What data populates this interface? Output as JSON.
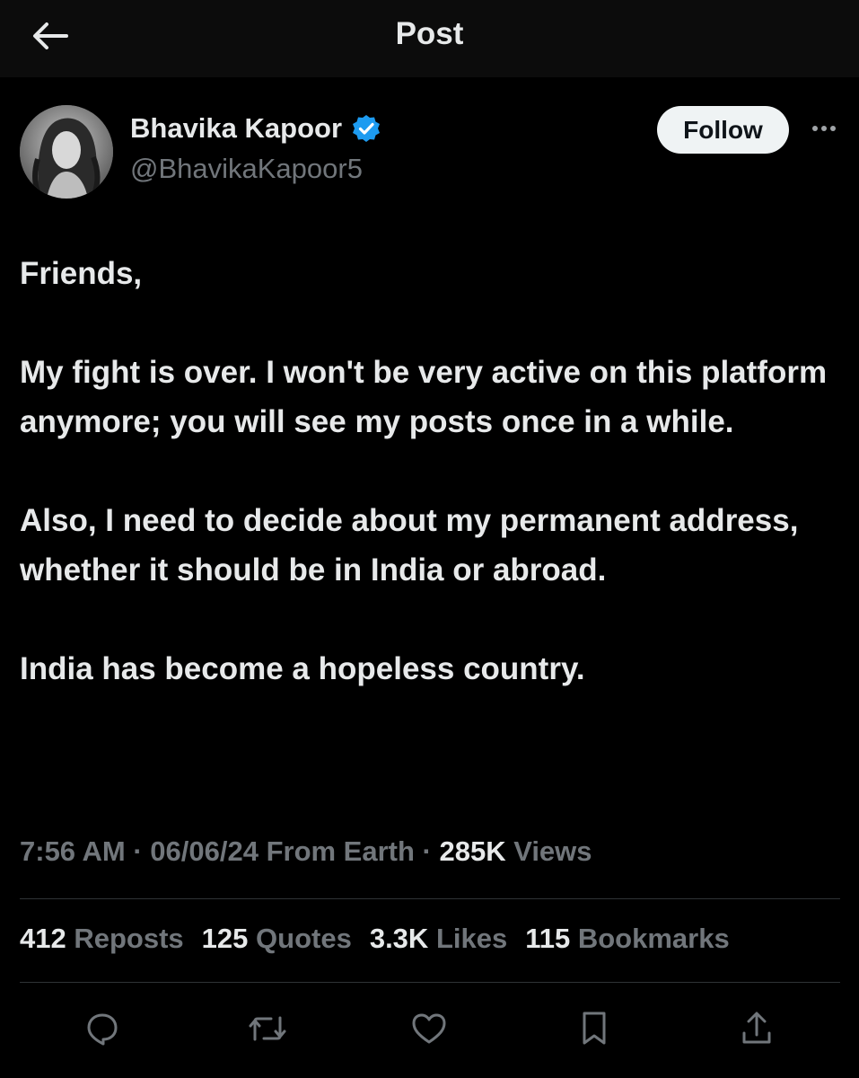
{
  "header": {
    "title": "Post",
    "back_icon": "arrow-left-icon"
  },
  "author": {
    "display_name": "Bhavika Kapoor",
    "handle": "@BhavikaKapoor5",
    "verified_icon": "verified-badge-icon",
    "verified_color": "#1d9bf0"
  },
  "follow_label": "Follow",
  "more_icon": "more-options-icon",
  "post": {
    "paragraphs": [
      "Friends,",
      "My fight is over. I won't be very active on this platform anymore; you will see my posts once in a while.",
      "Also, I need to decide about my permanent address, whether it should be in India or abroad.",
      "India has become a hopeless country."
    ]
  },
  "meta": {
    "time": "7:56 AM",
    "sep1": " · ",
    "date": "06/06/24",
    "source": " From Earth",
    "sep2": " · ",
    "views_count": "285K",
    "views_label": " Views"
  },
  "stats": [
    {
      "count": "412",
      "label": "Reposts"
    },
    {
      "count": "125",
      "label": "Quotes"
    },
    {
      "count": "3.3K",
      "label": "Likes"
    },
    {
      "count": "115",
      "label": "Bookmarks"
    }
  ],
  "actions": [
    "reply-icon",
    "repost-icon",
    "like-icon",
    "bookmark-icon",
    "share-icon"
  ],
  "colors": {
    "background": "#000000",
    "text": "#e7e9ea",
    "secondary": "#71767b",
    "divider": "#2f3336"
  }
}
